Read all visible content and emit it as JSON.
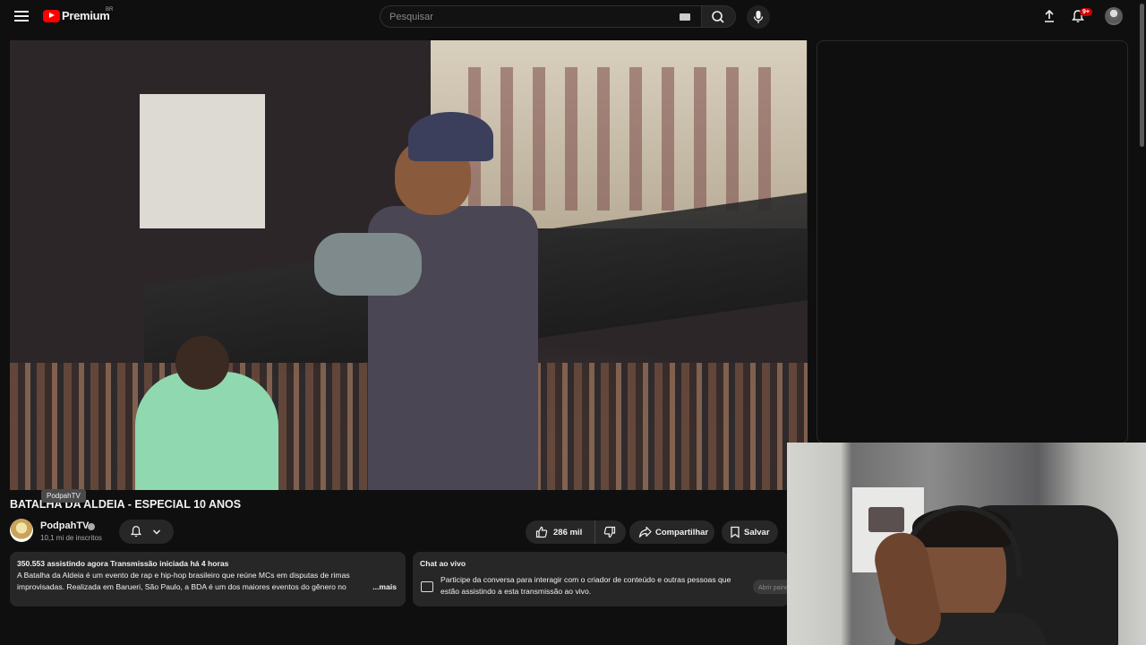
{
  "header": {
    "logo_text": "Premium",
    "logo_country": "BR",
    "search_placeholder": "Pesquisar",
    "notification_count": "9+"
  },
  "video": {
    "title": "BATALHA DA ALDEIA - ESPECIAL 10 ANOS",
    "tooltip": "PodpahTV"
  },
  "channel": {
    "name": "PodpahTV",
    "subscribers": "10,1 mi de inscritos"
  },
  "actions": {
    "likes": "286 mil",
    "share_label": "Compartilhar",
    "save_label": "Salvar"
  },
  "description": {
    "stats": "350.553 assistindo agora  Transmissão iniciada há 4 horas",
    "text": "A Batalha da Aldeia é um evento de rap e hip-hop brasileiro que reúne MCs em disputas de rimas improvisadas. Realizada em Barueri, São Paulo, a BDA é um dos maiores eventos do gênero no",
    "more_label": "...mais"
  },
  "live_chat": {
    "title": "Chat ao vivo",
    "text": "Participe da conversa para interagir com o criador de conteúdo e outras pessoas que estão assistindo a esta transmissão ao vivo.",
    "open_label": "Abrir painel"
  },
  "colors": {
    "background": "#0f0f0f",
    "brand_red": "#ff0000",
    "pill": "#272727",
    "badge": "#cc0000"
  },
  "icons": [
    "menu-icon",
    "youtube-logo-icon",
    "keyboard-icon",
    "search-icon",
    "mic-icon",
    "upload-icon",
    "bell-icon",
    "verified-icon",
    "bell-subscribe-icon",
    "chevron-down-icon",
    "thumbs-up-icon",
    "thumbs-down-icon",
    "share-icon",
    "bookmark-icon",
    "chat-icon"
  ]
}
